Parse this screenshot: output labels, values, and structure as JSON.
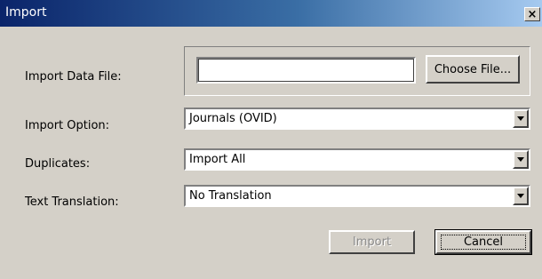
{
  "window": {
    "title": "Import",
    "close_label": "×"
  },
  "fields": {
    "data_file": {
      "label": "Import Data File:",
      "value": "",
      "choose_button": "Choose File..."
    },
    "import_option": {
      "label": "Import Option:",
      "value": "Journals (OVID)"
    },
    "duplicates": {
      "label": "Duplicates:",
      "value": "Import All"
    },
    "text_translation": {
      "label": "Text Translation:",
      "value": "No Translation"
    }
  },
  "buttons": {
    "import": "Import",
    "cancel": "Cancel"
  },
  "state": {
    "import_enabled": false,
    "cancel_focused": true
  },
  "icons": {
    "close": "close-icon",
    "dropdown": "chevron-down-icon"
  }
}
